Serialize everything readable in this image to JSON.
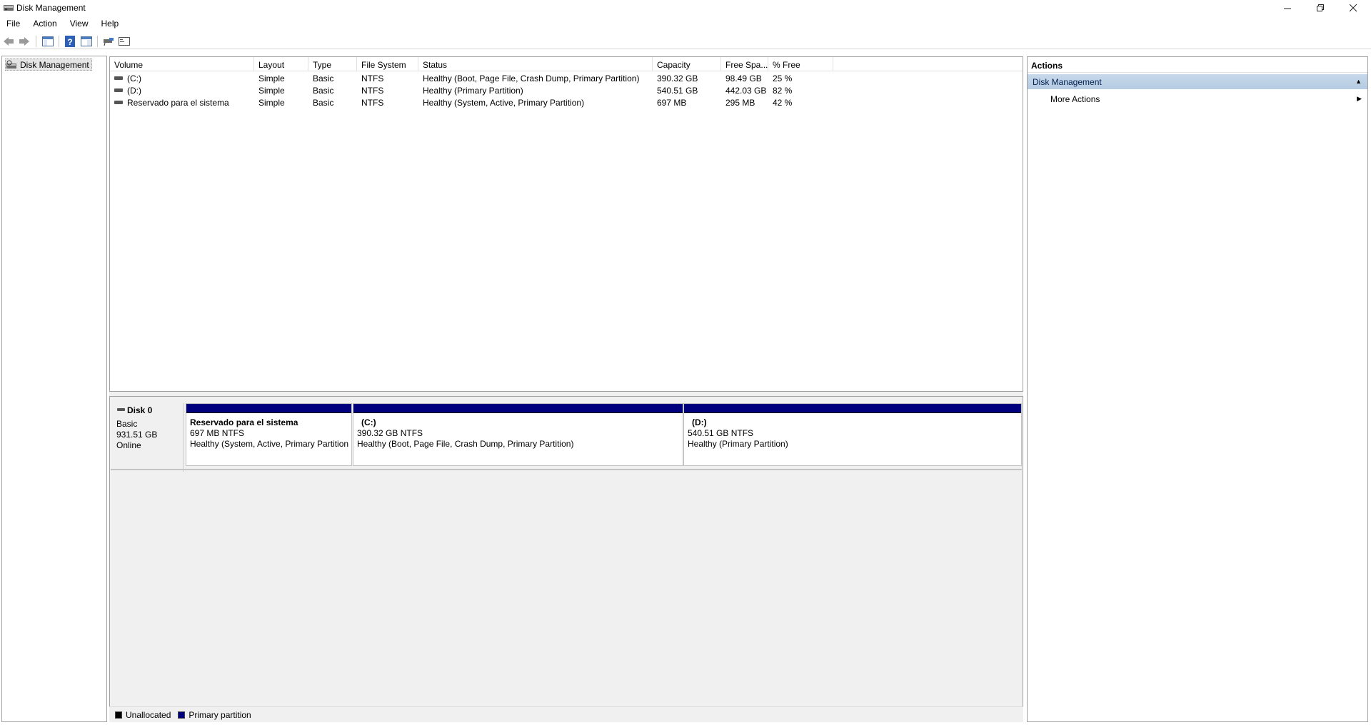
{
  "window": {
    "title": "Disk Management",
    "controls": {
      "minimize": "—",
      "maximize": "❐",
      "close": "✕"
    }
  },
  "menu": [
    "File",
    "Action",
    "View",
    "Help"
  ],
  "toolbar": {
    "icons": [
      "back-arrow-icon",
      "forward-arrow-icon",
      "show-hide-tree-icon",
      "help-icon",
      "properties-icon",
      "connect-icon",
      "console-icon"
    ]
  },
  "tree": {
    "root_label": "Disk Management"
  },
  "volume_table": {
    "columns": [
      "Volume",
      "Layout",
      "Type",
      "File System",
      "Status",
      "Capacity",
      "Free Spa...",
      "% Free"
    ],
    "rows": [
      {
        "volume": "(C:)",
        "layout": "Simple",
        "type": "Basic",
        "fs": "NTFS",
        "status": "Healthy (Boot, Page File, Crash Dump, Primary Partition)",
        "capacity": "390.32 GB",
        "free": "98.49 GB",
        "pct": "25 %"
      },
      {
        "volume": "(D:)",
        "layout": "Simple",
        "type": "Basic",
        "fs": "NTFS",
        "status": "Healthy (Primary Partition)",
        "capacity": "540.51 GB",
        "free": "442.03 GB",
        "pct": "82 %"
      },
      {
        "volume": "Reservado para el sistema",
        "layout": "Simple",
        "type": "Basic",
        "fs": "NTFS",
        "status": "Healthy (System, Active, Primary Partition)",
        "capacity": "697 MB",
        "free": "295 MB",
        "pct": "42 %"
      }
    ]
  },
  "disk": {
    "name": "Disk 0",
    "type": "Basic",
    "size": "931.51 GB",
    "state": "Online",
    "partitions": [
      {
        "name": "Reservado para el sistema",
        "size": "697 MB NTFS",
        "status": "Healthy (System, Active, Primary Partition"
      },
      {
        "name": "(C:)",
        "size": "390.32 GB NTFS",
        "status": "Healthy (Boot, Page File, Crash Dump, Primary Partition)"
      },
      {
        "name": "(D:)",
        "size": "540.51 GB NTFS",
        "status": "Healthy (Primary Partition)"
      }
    ]
  },
  "legend": [
    {
      "label": "Unallocated",
      "color": "#000000"
    },
    {
      "label": "Primary partition",
      "color": "#00007f"
    }
  ],
  "actions": {
    "title": "Actions",
    "group": "Disk Management",
    "items": [
      "More Actions"
    ]
  }
}
